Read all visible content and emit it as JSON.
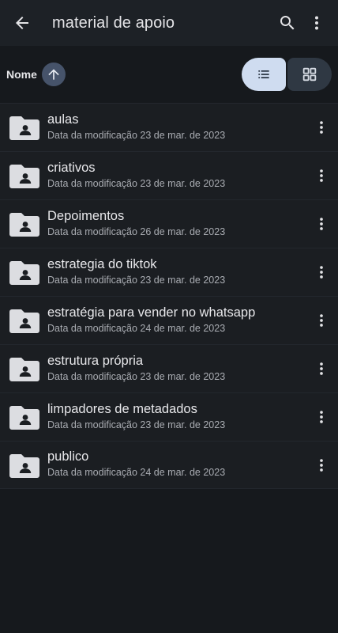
{
  "header": {
    "title": "material de apoio"
  },
  "sort": {
    "label": "Nome"
  },
  "files": [
    {
      "name": "aulas",
      "meta": "Data da modificação 23 de mar. de 2023"
    },
    {
      "name": "criativos",
      "meta": "Data da modificação 23 de mar. de 2023"
    },
    {
      "name": "Depoimentos",
      "meta": "Data da modificação 26 de mar. de 2023"
    },
    {
      "name": "estrategia do tiktok",
      "meta": "Data da modificação 23 de mar. de 2023"
    },
    {
      "name": "estratégia para vender no whatsapp",
      "meta": "Data da modificação 24 de mar. de 2023"
    },
    {
      "name": "estrutura própria",
      "meta": "Data da modificação 23 de mar. de 2023"
    },
    {
      "name": "limpadores de metadados",
      "meta": "Data da modificação 23 de mar. de 2023"
    },
    {
      "name": "publico",
      "meta": "Data da modificação 24 de mar. de 2023"
    }
  ],
  "icons": {
    "back": "arrow-back-icon",
    "search": "search-icon",
    "overflow": "more-vertical-icon",
    "sort": "arrow-up-icon",
    "list_view": "list-view-icon",
    "grid_view": "grid-view-icon",
    "folder": "shared-folder-icon"
  },
  "colors": {
    "background": "#16191d",
    "topbar": "#1d2126",
    "list_toggle_active": "#cfdcf0",
    "grid_toggle": "#2f3843",
    "sort_badge": "#46536a"
  }
}
